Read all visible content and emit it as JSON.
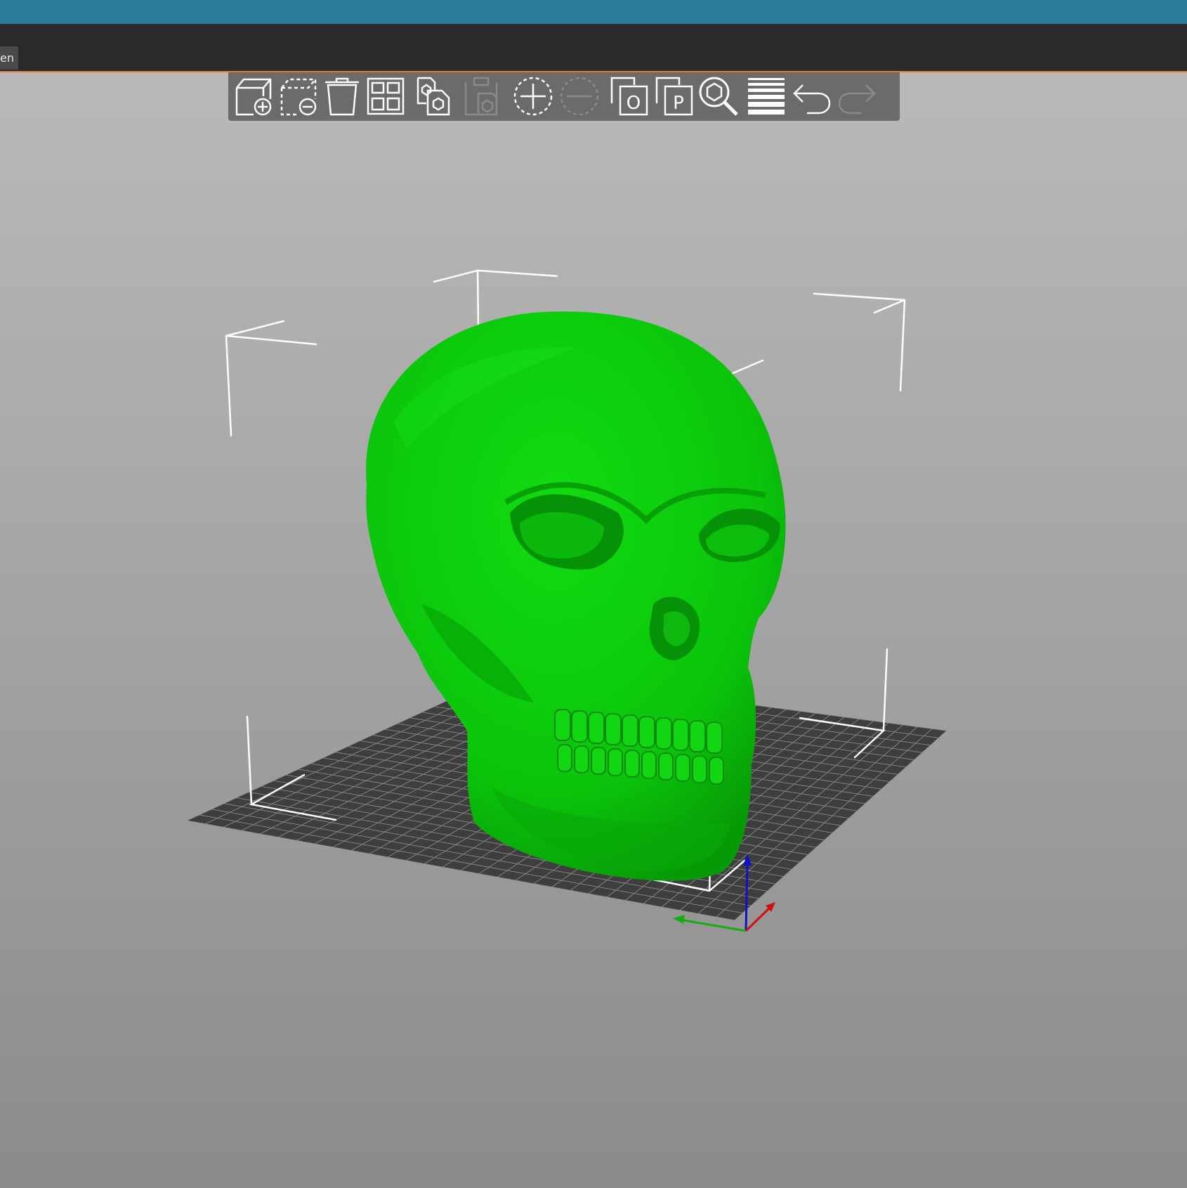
{
  "window": {
    "tab_label": "en"
  },
  "toolbar": {
    "buttons": [
      {
        "icon": "add-object-icon",
        "enabled": true
      },
      {
        "icon": "delete-object-icon",
        "enabled": true
      },
      {
        "icon": "delete-all-icon",
        "enabled": true
      },
      {
        "icon": "arrange-icon",
        "enabled": true
      },
      {
        "icon": "copy-icon",
        "enabled": true
      },
      {
        "icon": "paste-icon",
        "enabled": false
      },
      {
        "icon": "add-instance-icon",
        "enabled": true
      },
      {
        "icon": "remove-instance-icon",
        "enabled": false
      },
      {
        "icon": "split-to-objects-icon",
        "enabled": true
      },
      {
        "icon": "split-to-parts-icon",
        "enabled": true
      },
      {
        "icon": "search-icon",
        "enabled": true
      },
      {
        "icon": "layers-icon",
        "enabled": true
      },
      {
        "icon": "undo-icon",
        "enabled": true
      },
      {
        "icon": "redo-icon",
        "enabled": false
      }
    ],
    "split_objects_glyph": "O",
    "split_parts_glyph": "P"
  },
  "scene": {
    "model_color": "#0ccc0c",
    "bed_color": "#3e3e3e",
    "axis_colors": {
      "x": "#d01010",
      "y": "#10b010",
      "z": "#1010c8"
    }
  }
}
